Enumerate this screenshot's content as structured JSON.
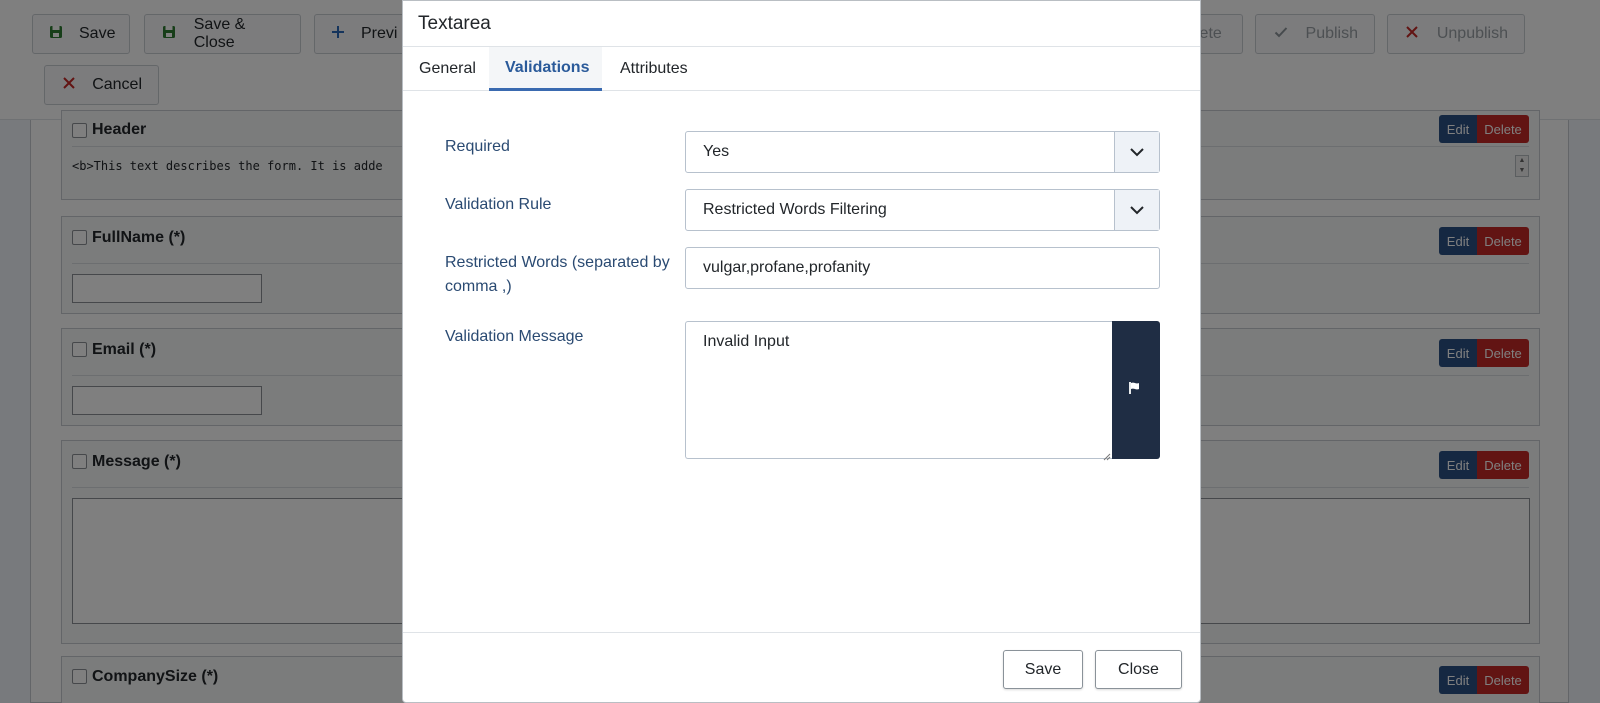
{
  "toolbar": {
    "buttons": [
      {
        "label": "Save",
        "icon": "floppy-disk-icon"
      },
      {
        "label": "Save & Close",
        "icon": "floppy-disk-icon"
      },
      {
        "label": "Previ",
        "icon": "plus-icon"
      },
      {
        "label": "lete",
        "icon": ""
      },
      {
        "label": "Publish",
        "icon": "check-icon"
      },
      {
        "label": "Unpublish",
        "icon": "x-icon"
      },
      {
        "label": "Cancel",
        "icon": "x-icon"
      }
    ]
  },
  "form": {
    "fields": [
      {
        "name": "Header",
        "content": "<b>This text describes the form. It is adde"
      },
      {
        "name": "FullName (*)"
      },
      {
        "name": "Email (*)"
      },
      {
        "name": "Message (*)"
      },
      {
        "name": "CompanySize (*)"
      }
    ],
    "edit_label": "Edit",
    "delete_label": "Delete"
  },
  "modal": {
    "title": "Textarea",
    "tabs": [
      {
        "label": "General",
        "active": false
      },
      {
        "label": "Validations",
        "active": true
      },
      {
        "label": "Attributes",
        "active": false
      }
    ],
    "rows": {
      "required": {
        "label": "Required",
        "value": "Yes"
      },
      "validation_rule": {
        "label": "Validation Rule",
        "value": "Restricted Words Filtering"
      },
      "restricted_words": {
        "label": "Restricted Words (separated by comma ,)",
        "value": "vulgar,profane,profanity"
      },
      "validation_message": {
        "label": "Validation Message",
        "value": "Invalid Input",
        "icon": "flag-icon"
      }
    },
    "footer": {
      "save_label": "Save",
      "close_label": "Close"
    }
  },
  "colors": {
    "accent": "#3a6ab0",
    "edit": "#2a5084",
    "delete": "#c52827",
    "flag_button": "#1f2d44"
  }
}
